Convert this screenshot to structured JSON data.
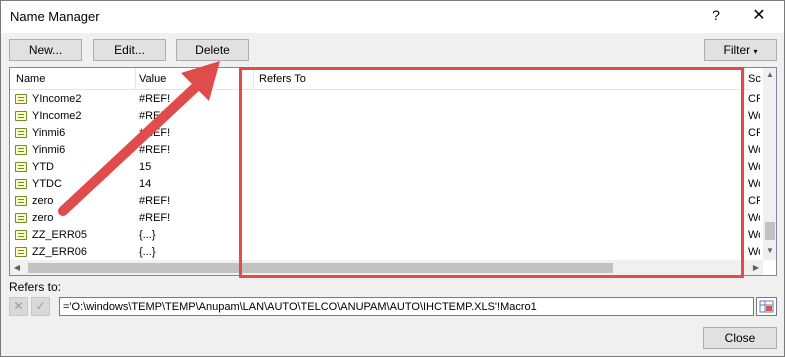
{
  "window": {
    "title": "Name Manager",
    "help_label": "?",
    "close_glyph": "✕"
  },
  "toolbar": {
    "new_label": "New...",
    "edit_label": "Edit...",
    "delete_label": "Delete",
    "filter_label": "Filter"
  },
  "list": {
    "columns": [
      "Name",
      "Value",
      "Refers To",
      "Sc"
    ],
    "rows": [
      {
        "name": "YIncome2",
        "value": "#REF!",
        "scope": "CF"
      },
      {
        "name": "YIncome2",
        "value": "#REF!",
        "scope": "Wo"
      },
      {
        "name": "Yinmi6",
        "value": "#REF!",
        "scope": "CF"
      },
      {
        "name": "Yinmi6",
        "value": "#REF!",
        "scope": "Wo"
      },
      {
        "name": "YTD",
        "value": "15",
        "scope": "Wo"
      },
      {
        "name": "YTDC",
        "value": "14",
        "scope": "Wo"
      },
      {
        "name": "zero",
        "value": "#REF!",
        "scope": "CF"
      },
      {
        "name": "zero",
        "value": "#REF!",
        "scope": "Wo"
      },
      {
        "name": "ZZ_ERR05",
        "value": "{...}",
        "scope": "Wo"
      },
      {
        "name": "ZZ_ERR06",
        "value": "{...}",
        "scope": "Wo"
      }
    ]
  },
  "refers_to": {
    "label": "Refers to:",
    "value": "='O:\\windows\\TEMP\\TEMP\\Anupam\\LAN\\AUTO\\TELCO\\ANUPAM\\AUTO\\IHCTEMP.XLS'!Macro1",
    "cancel_glyph": "✕",
    "confirm_glyph": "✓"
  },
  "footer": {
    "close_label": "Close"
  },
  "colors": {
    "highlight": "#e04b4b",
    "arrow": "#e04b4b"
  }
}
